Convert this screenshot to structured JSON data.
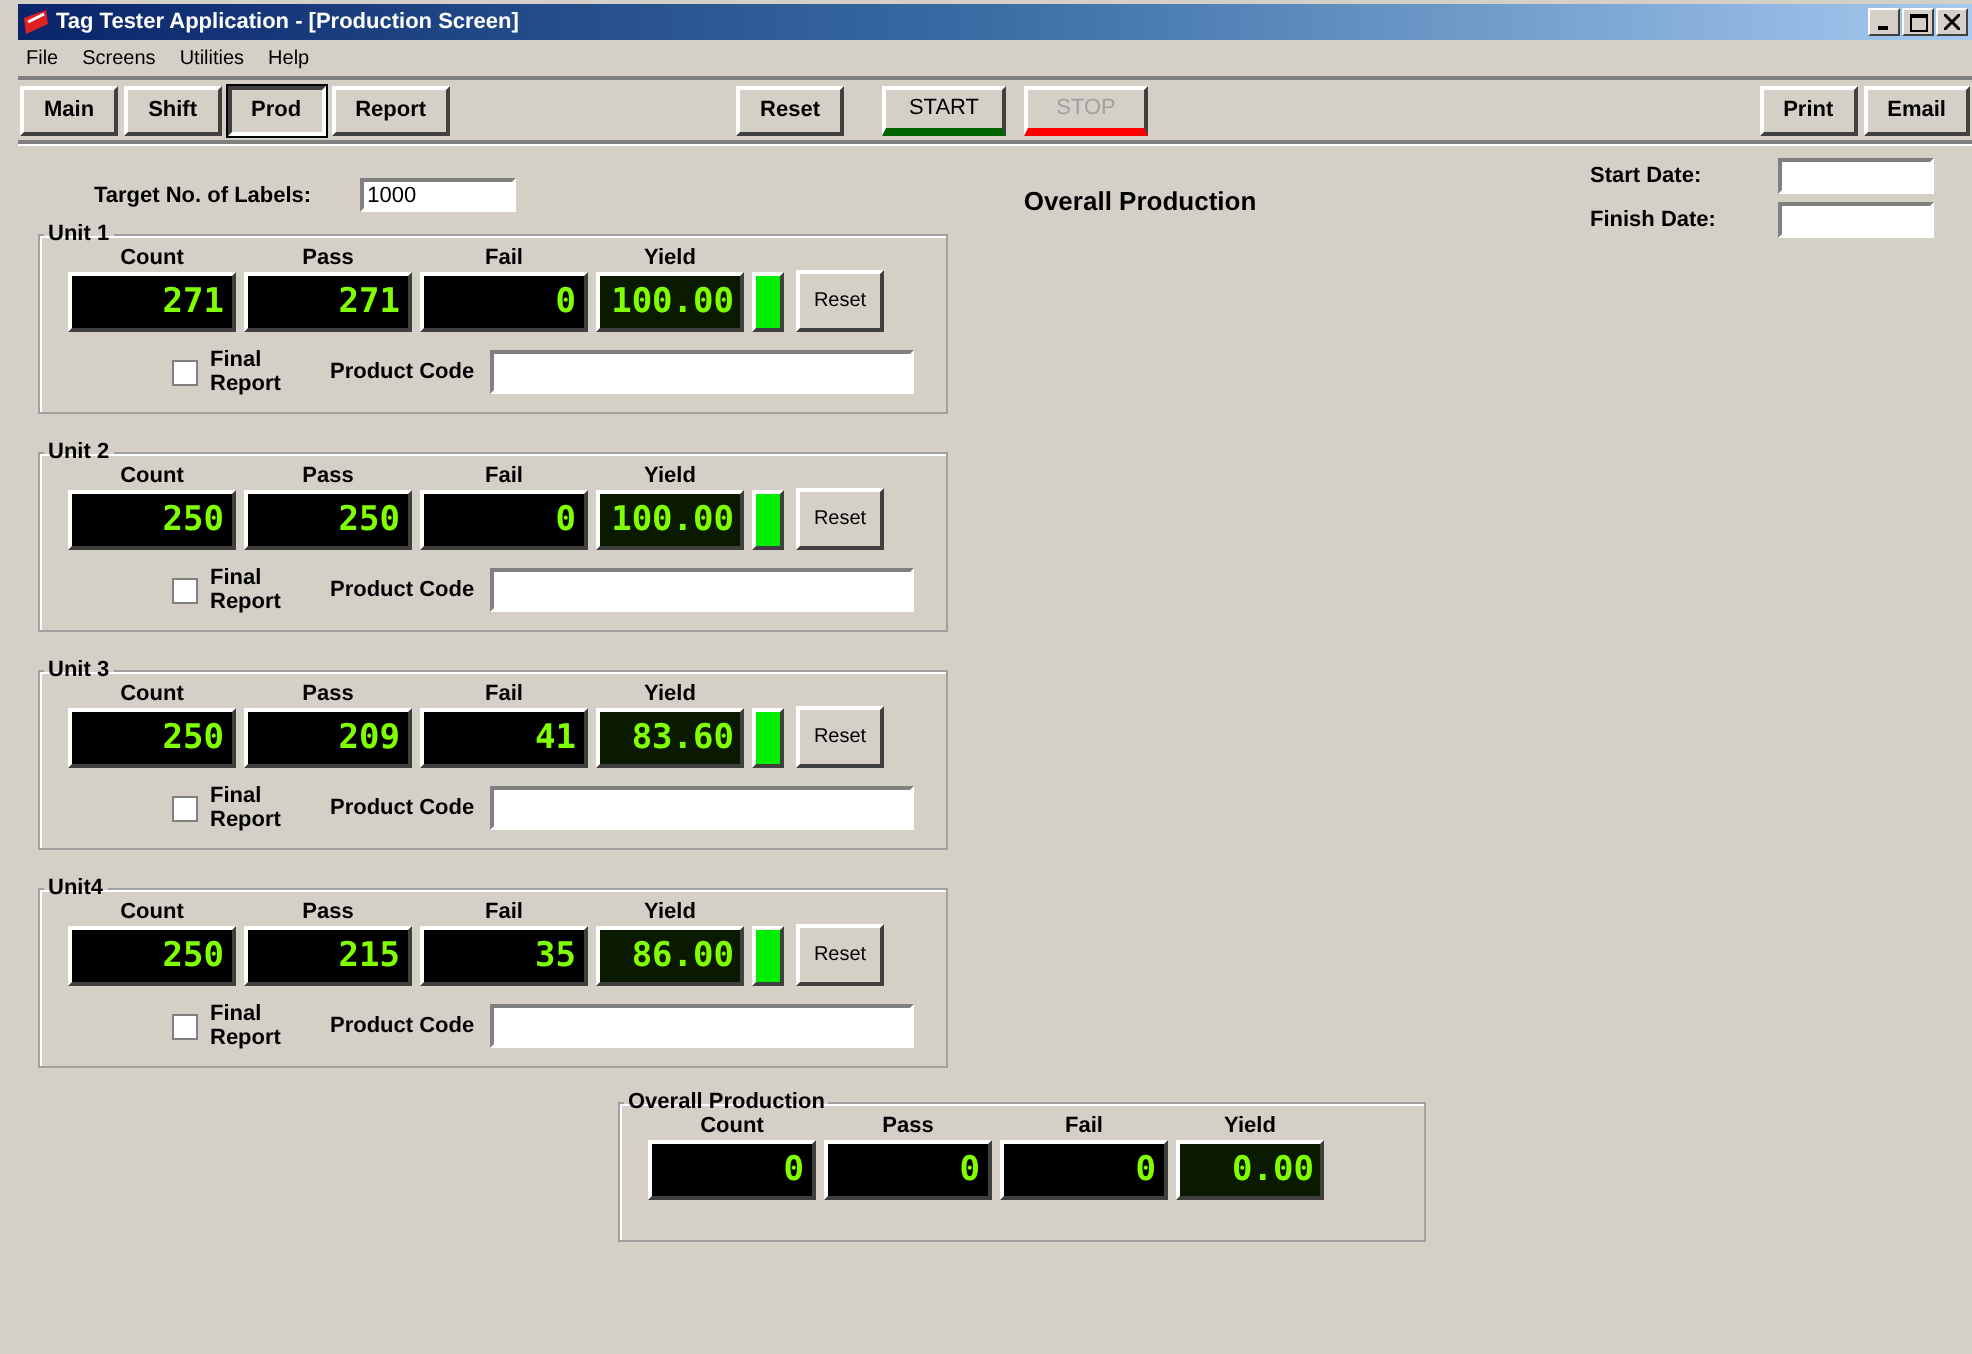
{
  "window": {
    "title": "Tag Tester Application - [Production Screen]"
  },
  "menu": [
    "File",
    "Screens",
    "Utilities",
    "Help"
  ],
  "nav_buttons": [
    {
      "label": "Main",
      "selected": false
    },
    {
      "label": "Shift",
      "selected": false
    },
    {
      "label": "Prod",
      "selected": true
    },
    {
      "label": "Report",
      "selected": false
    }
  ],
  "reset_button": "Reset",
  "run_buttons": [
    {
      "label": "START",
      "kind": "start",
      "disabled": false
    },
    {
      "label": "STOP",
      "kind": "stop",
      "disabled": true
    }
  ],
  "output_buttons": [
    "Print",
    "Email"
  ],
  "target": {
    "label": "Target No. of Labels:",
    "value": "1000"
  },
  "heading": "Overall Production",
  "dates": [
    {
      "label": "Start Date:"
    },
    {
      "label": "Finish Date:"
    }
  ],
  "units": [
    {
      "title": "Unit 1",
      "labels": [
        "Count",
        "Pass",
        "Fail",
        "Yield"
      ],
      "count": "271",
      "pass": "271",
      "fail": "0",
      "yield": "100.00",
      "final_report": {
        "label": "Final Report",
        "checked": false
      },
      "product_code_label": "Product Code",
      "reset": "Reset"
    },
    {
      "title": "Unit 2",
      "labels": [
        "Count",
        "Pass",
        "Fail",
        "Yield"
      ],
      "count": "250",
      "pass": "250",
      "fail": "0",
      "yield": "100.00",
      "final_report": {
        "label": "Final Report",
        "checked": false
      },
      "product_code_label": "Product Code",
      "reset": "Reset"
    },
    {
      "title": "Unit 3",
      "labels": [
        "Count",
        "Pass",
        "Fail",
        "Yield"
      ],
      "count": "250",
      "pass": "209",
      "fail": "41",
      "yield": "83.60",
      "final_report": {
        "label": "Final Report",
        "checked": false
      },
      "product_code_label": "Product Code",
      "reset": "Reset"
    },
    {
      "title": "Unit4",
      "labels": [
        "Count",
        "Pass",
        "Fail",
        "Yield"
      ],
      "count": "250",
      "pass": "215",
      "fail": "35",
      "yield": "86.00",
      "final_report": {
        "label": "Final Report",
        "checked": false
      },
      "product_code_label": "Product Code",
      "reset": "Reset"
    }
  ],
  "overall": {
    "title": "Overall Production",
    "labels": [
      "Count",
      "Pass",
      "Fail",
      "Yield"
    ],
    "count": "0",
    "pass": "0",
    "fail": "0",
    "yield": "0.00"
  }
}
